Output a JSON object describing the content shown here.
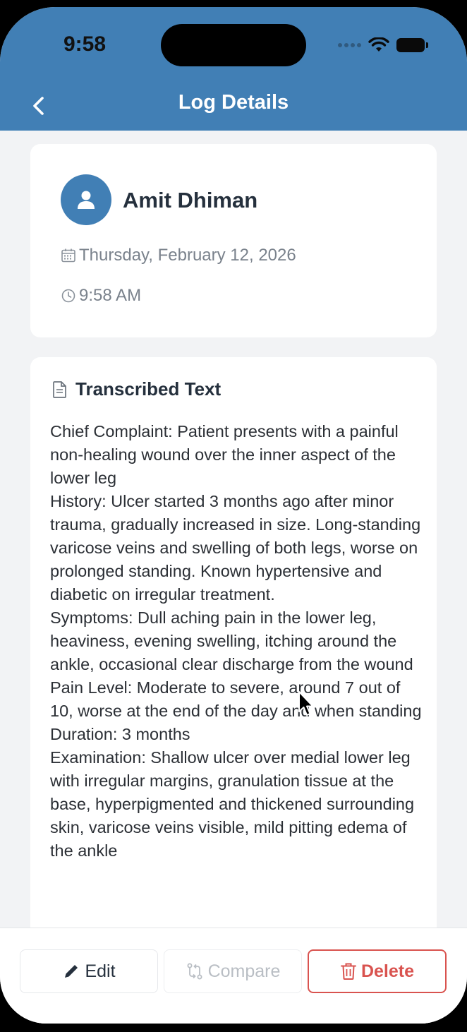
{
  "status_bar": {
    "time": "9:58"
  },
  "nav": {
    "title": "Log Details"
  },
  "profile": {
    "name": "Amit Dhiman",
    "date": "Thursday, February 12, 2026",
    "time": "9:58 AM"
  },
  "transcript": {
    "heading": "Transcribed Text",
    "body": "Chief Complaint: Patient presents with a painful non-healing wound over the inner aspect of the lower leg\nHistory: Ulcer started 3 months ago after minor trauma, gradually increased in size. Long-standing varicose veins and swelling of both legs, worse on prolonged standing. Known hypertensive and diabetic on irregular treatment.\nSymptoms: Dull aching pain in the lower leg, heaviness, evening swelling, itching around the ankle, occasional clear discharge from the wound\nPain Level: Moderate to severe, around 7 out of 10, worse at the end of the day and when standing\nDuration: 3 months\nExamination: Shallow ulcer over medial lower leg with irregular margins, granulation tissue at the base, hyperpigmented and thickened surrounding skin, varicose veins visible, mild pitting edema of the ankle"
  },
  "actions": {
    "edit_label": "Edit",
    "compare_label": "Compare",
    "delete_label": "Delete"
  },
  "colors": {
    "primary": "#417fb5",
    "danger": "#d9534f",
    "background": "#f2f3f5"
  }
}
